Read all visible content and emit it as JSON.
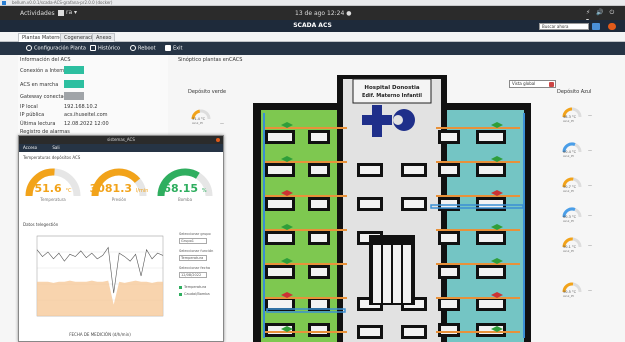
{
  "window": {
    "title": "bellum.v0.0.1/scada-ACS-grafana-pr2.0.0 (docker)",
    "gnome_activities": "Actividades",
    "app_menu": "ra ▾",
    "clock": "13 de ago  12:24 ●",
    "tray": "⚡ 🔊 ⏻ ▾",
    "app_title": "SCADA ACS",
    "search_value": "Buscar ahora"
  },
  "tabs": [
    {
      "label": "Plantas Materno"
    },
    {
      "label": "Cogeneración"
    },
    {
      "label": "Anexo"
    }
  ],
  "toolbar": {
    "config_label": "Configuración Planta",
    "historico_label": "Histórico",
    "reboot_label": "Reboot",
    "exit_label": "Exit"
  },
  "info": {
    "title": "Información del ACS",
    "rows": [
      {
        "label": "Conexión a Internet",
        "kind": "box",
        "color": "#2dbfa0"
      },
      {
        "label": "ACS en marcha",
        "kind": "box",
        "color": "#2dbfa0"
      },
      {
        "label": "Gateway conectado",
        "kind": "box",
        "color": "#a0a4a8"
      },
      {
        "label": "IP local",
        "kind": "text",
        "value": "192.168.10.2"
      },
      {
        "label": "IP pública",
        "kind": "text",
        "value": "acs.ihuseitel.com"
      },
      {
        "label": "Última lectura",
        "kind": "text",
        "value": "12.08.2022 12:00"
      },
      {
        "label": "Registro de alarmas",
        "kind": "text",
        "value": ""
      }
    ]
  },
  "center_title": "Sinóptico plantas enCACS",
  "labels": {
    "left_tower": "Depósito verde",
    "right_tower": "Depósito Azul",
    "callout": "Vista global"
  },
  "building": {
    "sign_line1": "Hospital Donostia",
    "sign_line2": "Edif. Materno Infantil"
  },
  "side_gauges_left": [
    {
      "value": "31.4",
      "unit": "°C",
      "label": "Azul_Pt",
      "color": "#f2a31a",
      "fraction": 0.45
    }
  ],
  "side_gauges_right": [
    {
      "value": "48.3",
      "unit": "°C",
      "label": "Azul_Pt",
      "color": "#f2a31a",
      "fraction": 0.5
    },
    {
      "value": "60.4",
      "unit": "°C",
      "label": "Azul_Pt",
      "color": "#4a9ee8",
      "fraction": 0.62
    },
    {
      "value": "50.7",
      "unit": "°C",
      "label": "Azul_Pt",
      "color": "#f2a31a",
      "fraction": 0.55
    },
    {
      "value": "60.3",
      "unit": "°C",
      "label": "Azul_Pt",
      "color": "#4a9ee8",
      "fraction": 0.62
    },
    {
      "value": "50.1",
      "unit": "°C",
      "label": "Azul_Pt",
      "color": "#f2a31a",
      "fraction": 0.53
    },
    {
      "value": "50.5",
      "unit": "°C",
      "label": "Azul_Pt",
      "color": "#f2a31a",
      "fraction": 0.54
    }
  ],
  "overlay": {
    "title": "sistemas_ACS",
    "tb_left": "Acceso",
    "tb_right": "Sali",
    "section1": "Temperaturas depósitos ACS",
    "section2": "Datos telegestión",
    "gauges": [
      {
        "value": "51.6",
        "unit": "°C",
        "label": "Temperatura",
        "color": "#f2a31a",
        "fraction": 0.52
      },
      {
        "value": "3081.3",
        "unit": "l/min",
        "label": "Presión",
        "color": "#f2a31a",
        "fraction": 0.78
      },
      {
        "value": "68.15",
        "unit": "%",
        "label": "Bomba",
        "color": "#2fae5f",
        "fraction": 0.68
      }
    ],
    "ctrl_labels": [
      "Seleccionar grupo",
      "Seleccionar función",
      "Seleccionar fecha"
    ],
    "ctrl_values": [
      "Grupo1",
      "Temperatura",
      "12/08/2022"
    ],
    "checks": [
      "Temperatura",
      "Caudal/Bomba"
    ],
    "xlabel": "FECHA DE MEDICIÓN (d/h/min)"
  },
  "chart_data": {
    "type": "line",
    "series": [
      {
        "name": "",
        "values": [
          58,
          52,
          56,
          50,
          55,
          48,
          54,
          52,
          57,
          51,
          55,
          50,
          53,
          60,
          20,
          55,
          52,
          48,
          54,
          35,
          58,
          50,
          55,
          53
        ]
      },
      {
        "name": "",
        "values": [
          30,
          30,
          30,
          29,
          30,
          30,
          31,
          30,
          30,
          30,
          31,
          30,
          30,
          31,
          10,
          30,
          29,
          30,
          31,
          30,
          30,
          29,
          30,
          30
        ]
      }
    ],
    "xlabel": "FECHA DE MEDICIÓN (d/h/min)",
    "ylim": [
      0,
      70
    ],
    "grid": true
  }
}
